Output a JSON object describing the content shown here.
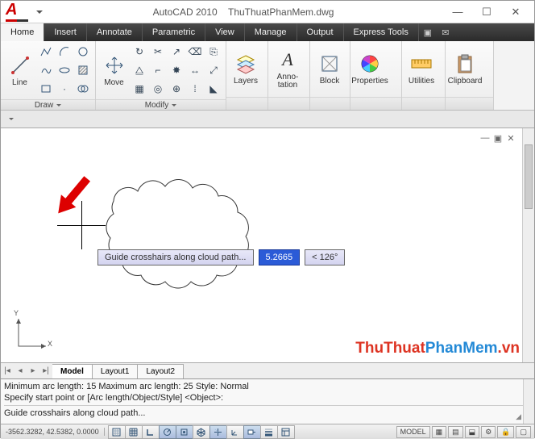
{
  "title": {
    "app": "AutoCAD 2010",
    "file": "ThuThuatPhanMem.dwg"
  },
  "winbtns": {
    "min": "—",
    "max": "☐",
    "close": "✕"
  },
  "tabs": [
    "Home",
    "Insert",
    "Annotate",
    "Parametric",
    "View",
    "Manage",
    "Output",
    "Express Tools"
  ],
  "ribbon": {
    "draw": {
      "title": "Draw",
      "line": "Line"
    },
    "modify": {
      "title": "Modify",
      "move": "Move"
    },
    "layers": "Layers",
    "anno": {
      "label1": "Anno-",
      "label2": "tation"
    },
    "block": "Block",
    "props": "Properties",
    "util": "Utilities",
    "clip": "Clipboard"
  },
  "dyn": {
    "prompt": "Guide crosshairs along cloud path...",
    "dist": "5.2665",
    "angle": "< 126°"
  },
  "watermark": {
    "a": "ThuThuat",
    "b": "PhanMem",
    "c": ".vn"
  },
  "layouts": [
    "Model",
    "Layout1",
    "Layout2"
  ],
  "cmd": {
    "l1": "Minimum arc length: 15   Maximum arc length: 25   Style: Normal",
    "l2": "Specify start point or [Arc length/Object/Style] <Object>:",
    "l3": "Guide crosshairs along cloud path..."
  },
  "status": {
    "coords": "-3562.3282, 42.5382, 0.0000",
    "model": "MODEL"
  },
  "mini": {
    "a": "—",
    "b": "▣",
    "c": "✕"
  }
}
